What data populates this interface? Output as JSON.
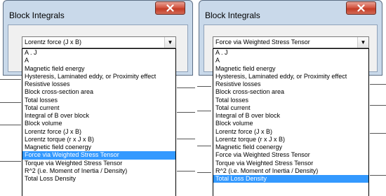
{
  "panels": [
    {
      "title": "Block Integrals",
      "combo_value": "Lorentz force (J x B)",
      "selected_index": 13,
      "items": [
        "A . J",
        "A",
        "Magnetic field energy",
        "Hysteresis, Laminated eddy, or Proximity effect",
        "Resistive losses",
        "Block cross-section area",
        "Total losses",
        "Total current",
        "Integral of B over block",
        "Block volume",
        "Lorentz force (J x B)",
        "Lorentz torque (r x J x B)",
        "Magnetic field coenergy",
        "Force via Weighted Stress Tensor",
        "Torque via Weighted Stress Tensor",
        "R^2 (i.e. Moment of Inertia / Density)",
        "Total Loss Density"
      ]
    },
    {
      "title": "Block Integrals",
      "combo_value": "Force via Weighted Stress Tensor",
      "selected_index": 16,
      "items": [
        "A . J",
        "A",
        "Magnetic field energy",
        "Hysteresis, Laminated eddy, or Proximity effect",
        "Resistive losses",
        "Block cross-section area",
        "Total losses",
        "Total current",
        "Integral of B over block",
        "Block volume",
        "Lorentz force (J x B)",
        "Lorentz torque (r x J x B)",
        "Magnetic field coenergy",
        "Force via Weighted Stress Tensor",
        "Torque via Weighted Stress Tensor",
        "R^2 (i.e. Moment of Inertia / Density)",
        "Total Loss Density"
      ]
    }
  ],
  "colors": {
    "selection": "#3399ff",
    "frame": "#c9d9ea",
    "close_button": "#c33b26"
  },
  "icons": [
    "close-icon",
    "dropdown-arrow-icon"
  ]
}
